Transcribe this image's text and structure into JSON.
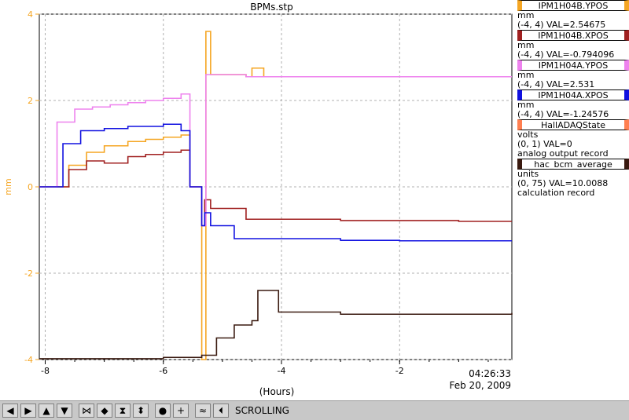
{
  "chart_data": {
    "type": "line",
    "title": "BPMs.stp",
    "xlabel": "(Hours)",
    "ylabel": "mm",
    "xlim": [
      -8.1,
      -0.1
    ],
    "ylim": [
      -4,
      4
    ],
    "xticks": [
      -8,
      -6,
      -4,
      -2
    ],
    "yticks": [
      -4,
      -2,
      0,
      2,
      4
    ],
    "grid": true,
    "time_label": "04:26:33",
    "date_label": "Feb 20, 2009",
    "series": [
      {
        "name": "IPM1H04B.YPOS",
        "color": "#f5a623",
        "points": [
          [
            -8.1,
            0
          ],
          [
            -7.9,
            0
          ],
          [
            -7.6,
            0.5
          ],
          [
            -7.3,
            0.8
          ],
          [
            -7,
            0.95
          ],
          [
            -6.6,
            1.05
          ],
          [
            -6.3,
            1.1
          ],
          [
            -6,
            1.15
          ],
          [
            -5.7,
            1.2
          ],
          [
            -5.55,
            0
          ],
          [
            -5.4,
            0
          ],
          [
            -5.35,
            -4
          ],
          [
            -5.3,
            -4
          ],
          [
            -5.28,
            3.6
          ],
          [
            -5.2,
            2.6
          ],
          [
            -4.6,
            2.55
          ],
          [
            -4.5,
            2.75
          ],
          [
            -4.3,
            2.55
          ],
          [
            -3,
            2.55
          ],
          [
            -2,
            2.55
          ],
          [
            -1,
            2.55
          ],
          [
            -0.1,
            2.55
          ]
        ]
      },
      {
        "name": "IPM1H04B.XPOS",
        "color": "#a02020",
        "points": [
          [
            -8.1,
            0
          ],
          [
            -7.9,
            0
          ],
          [
            -7.6,
            0.4
          ],
          [
            -7.3,
            0.6
          ],
          [
            -7,
            0.55
          ],
          [
            -6.6,
            0.7
          ],
          [
            -6.3,
            0.75
          ],
          [
            -6,
            0.8
          ],
          [
            -5.7,
            0.85
          ],
          [
            -5.55,
            0
          ],
          [
            -5.4,
            0
          ],
          [
            -5.35,
            -0.9
          ],
          [
            -5.3,
            -0.3
          ],
          [
            -5.2,
            -0.5
          ],
          [
            -4.6,
            -0.75
          ],
          [
            -3,
            -0.78
          ],
          [
            -2,
            -0.78
          ],
          [
            -1,
            -0.8
          ],
          [
            -0.1,
            -0.8
          ]
        ]
      },
      {
        "name": "IPM1H04A.YPOS",
        "color": "#ee82ee",
        "points": [
          [
            -8.1,
            0
          ],
          [
            -7.9,
            0
          ],
          [
            -7.8,
            1.5
          ],
          [
            -7.5,
            1.8
          ],
          [
            -7.2,
            1.85
          ],
          [
            -6.9,
            1.9
          ],
          [
            -6.6,
            1.95
          ],
          [
            -6.3,
            2
          ],
          [
            -6,
            2.05
          ],
          [
            -5.7,
            2.15
          ],
          [
            -5.55,
            0
          ],
          [
            -5.4,
            0
          ],
          [
            -5.35,
            -0.9
          ],
          [
            -5.28,
            2.6
          ],
          [
            -4.6,
            2.55
          ],
          [
            -3,
            2.55
          ],
          [
            -2,
            2.55
          ],
          [
            -1,
            2.55
          ],
          [
            -0.1,
            2.55
          ]
        ]
      },
      {
        "name": "IPM1H04A.XPOS",
        "color": "#1010e0",
        "points": [
          [
            -8.1,
            0
          ],
          [
            -7.9,
            0
          ],
          [
            -7.7,
            1
          ],
          [
            -7.4,
            1.3
          ],
          [
            -7,
            1.35
          ],
          [
            -6.6,
            1.4
          ],
          [
            -6.3,
            1.4
          ],
          [
            -6,
            1.45
          ],
          [
            -5.7,
            1.3
          ],
          [
            -5.55,
            0
          ],
          [
            -5.4,
            0
          ],
          [
            -5.35,
            -0.9
          ],
          [
            -5.3,
            -0.6
          ],
          [
            -5.2,
            -0.9
          ],
          [
            -4.8,
            -1.2
          ],
          [
            -3,
            -1.24
          ],
          [
            -2,
            -1.25
          ],
          [
            -1,
            -1.25
          ],
          [
            -0.1,
            -1.25
          ]
        ]
      },
      {
        "name": "HallADAQState",
        "color": "#ff7f50",
        "points": []
      },
      {
        "name": "hac_bcm_average",
        "color": "#3a1a10",
        "points": [
          [
            -8.1,
            -3.98
          ],
          [
            -7,
            -3.98
          ],
          [
            -6,
            -3.95
          ],
          [
            -5.5,
            -3.95
          ],
          [
            -5.35,
            -3.9
          ],
          [
            -5.1,
            -3.5
          ],
          [
            -4.8,
            -3.2
          ],
          [
            -4.5,
            -3.1
          ],
          [
            -4.4,
            -2.4
          ],
          [
            -4.1,
            -2.4
          ],
          [
            -4.05,
            -2.9
          ],
          [
            -3,
            -2.95
          ],
          [
            -2,
            -2.95
          ],
          [
            -1,
            -2.95
          ],
          [
            -0.1,
            -2.92
          ]
        ]
      }
    ]
  },
  "legend": [
    {
      "name": "IPM1H04B.YPOS",
      "units": "mm",
      "range_val": "(-4, 4) VAL=2.54675",
      "extra": ""
    },
    {
      "name": "IPM1H04B.XPOS",
      "units": "mm",
      "range_val": "(-4, 4) VAL=-0.794096",
      "extra": ""
    },
    {
      "name": "IPM1H04A.YPOS",
      "units": "mm",
      "range_val": "(-4, 4) VAL=2.531",
      "extra": ""
    },
    {
      "name": "IPM1H04A.XPOS",
      "units": "mm",
      "range_val": "(-4, 4) VAL=-1.24576",
      "extra": ""
    },
    {
      "name": "HallADAQState",
      "units": "volts",
      "range_val": "(0, 1) VAL=0",
      "extra": "analog output record"
    },
    {
      "name": "hac_bcm_average",
      "units": "units",
      "range_val": "(0, 75) VAL=10.0088",
      "extra": "calculation record"
    }
  ],
  "legend_colors": [
    "#f5a623",
    "#a02020",
    "#ee82ee",
    "#1010e0",
    "#ff7f50",
    "#3a1a10"
  ],
  "toolbar": {
    "buttons": [
      {
        "icon": "arrow-left-icon",
        "glyph": "◀"
      },
      {
        "icon": "arrow-right-icon",
        "glyph": "▶"
      },
      {
        "icon": "arrow-up-icon",
        "glyph": "▲"
      },
      {
        "icon": "arrow-down-icon",
        "glyph": "▼"
      },
      {
        "icon": "zoom-in-x-icon",
        "glyph": "⋈"
      },
      {
        "icon": "zoom-out-x-icon",
        "glyph": "◆"
      },
      {
        "icon": "zoom-in-y-icon",
        "glyph": "⧗"
      },
      {
        "icon": "zoom-out-y-icon",
        "glyph": "⬍"
      },
      {
        "icon": "record-icon",
        "glyph": "●"
      },
      {
        "icon": "add-icon",
        "glyph": "+"
      },
      {
        "icon": "graph-icon",
        "glyph": "≈"
      },
      {
        "icon": "scroll-icon",
        "glyph": "⏴"
      }
    ],
    "status_label": "SCROLLING"
  }
}
